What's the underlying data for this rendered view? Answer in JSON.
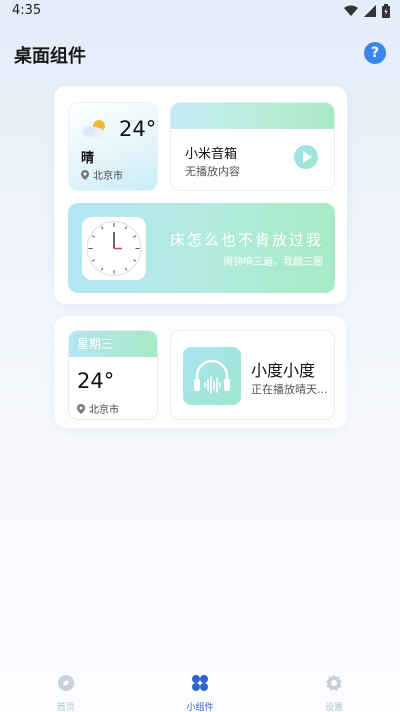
{
  "status_bar": {
    "time": "4:35"
  },
  "header": {
    "title": "桌面组件",
    "help_label": "?"
  },
  "weather_widget": {
    "temperature": "24°",
    "condition": "晴",
    "location": "北京市"
  },
  "speaker_widget": {
    "name": "小米音箱",
    "status": "无播放内容"
  },
  "alarm_widget": {
    "title": "床怎么也不肯放过我",
    "subtitle": "闹钟响三遍，我翻三圈"
  },
  "week_widget": {
    "day": "星期三",
    "temperature": "24°",
    "location": "北京市"
  },
  "xiaodu_widget": {
    "name": "小度小度",
    "status": "正在播放晴天..."
  },
  "bottom_nav": {
    "home_label": "首页",
    "widgets_label": "小组件",
    "settings_label": "设置"
  }
}
